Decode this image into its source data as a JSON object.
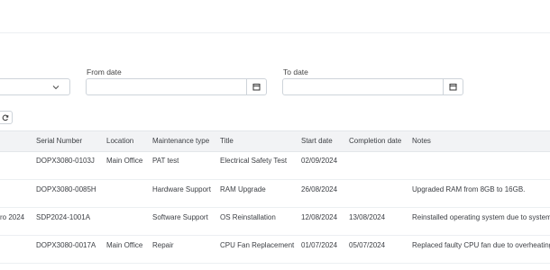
{
  "filters": {
    "from_date_label": "From date",
    "to_date_label": "To date",
    "from_date_value": "",
    "to_date_value": ""
  },
  "table": {
    "headers": [
      "Serial Number",
      "Location",
      "Maintenance type",
      "Title",
      "Start date",
      "Completion date",
      "Notes"
    ],
    "rows": [
      {
        "left": "",
        "serial": "DOPX3080-0103J",
        "location": "Main Office",
        "type": "PAT test",
        "title": "Electrical Safety Test",
        "start": "02/09/2024",
        "completion": "",
        "notes": ""
      },
      {
        "left": "",
        "serial": "DOPX3080-0085H",
        "location": "",
        "type": "Hardware Support",
        "title": "RAM Upgrade",
        "start": "26/08/2024",
        "completion": "",
        "notes": "Upgraded RAM from 8GB to 16GB."
      },
      {
        "left": "ro 2024",
        "serial": "SDP2024-1001A",
        "location": "",
        "type": "Software Support",
        "title": "OS Reinstallation",
        "start": "12/08/2024",
        "completion": "13/08/2024",
        "notes": "Reinstalled operating system due to system e"
      },
      {
        "left": "",
        "serial": "DOPX3080-0017A",
        "location": "Main Office",
        "type": "Repair",
        "title": "CPU Fan Replacement",
        "start": "01/07/2024",
        "completion": "05/07/2024",
        "notes": "Replaced faulty CPU fan due to overheating is"
      }
    ]
  },
  "icons": {
    "dropdown": "chevron-down-icon",
    "calendar": "calendar-icon",
    "refresh": "refresh-icon"
  }
}
